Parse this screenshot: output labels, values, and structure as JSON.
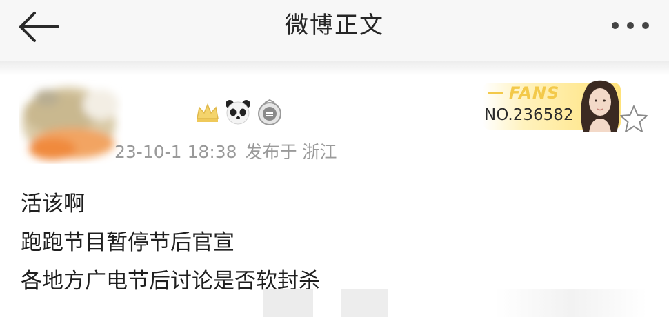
{
  "nav": {
    "title": "微博正文",
    "back_icon": "arrow-left-icon",
    "more_icon": "ellipsis-icon"
  },
  "post": {
    "timestamp": "23-10-1 18:38",
    "location": "发布于 浙江",
    "badges": [
      "crown-icon",
      "panda-icon",
      "vip-medal-icon"
    ],
    "fans_badge": {
      "label": "FANS",
      "number": "NO.236582"
    },
    "content_lines": [
      "活该啊",
      "跑跑节目暂停节后官宣",
      "各地方广电节后讨论是否软封杀"
    ]
  },
  "colors": {
    "nav_bg": "#f7f7f7",
    "meta_text": "#9a9a9a",
    "fans_gold": "#f3c94a"
  }
}
